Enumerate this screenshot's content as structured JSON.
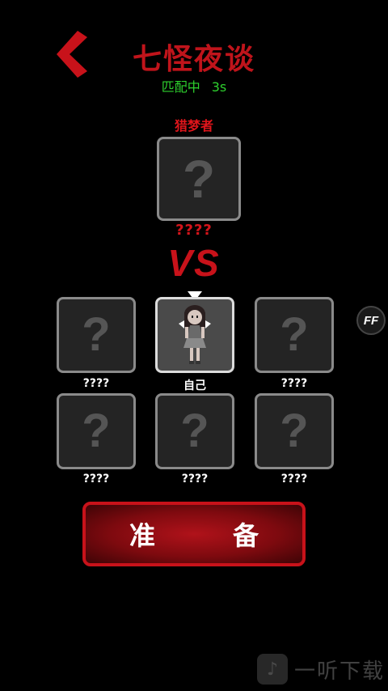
{
  "header": {
    "title": "七怪夜谈",
    "status": "匹配中",
    "timer": "3s"
  },
  "hunter": {
    "role_label": "猎梦者",
    "name": "????"
  },
  "vs_text": "VS",
  "players": [
    {
      "name": "????",
      "is_self": false
    },
    {
      "name": "自己",
      "is_self": true
    },
    {
      "name": "????",
      "is_self": false
    },
    {
      "name": "????",
      "is_self": false
    },
    {
      "name": "????",
      "is_self": false
    },
    {
      "name": "????",
      "is_self": false
    }
  ],
  "unknown_mark": "?",
  "ff_label": "FF",
  "ready_button": {
    "left": "准",
    "right": "备"
  },
  "watermark": {
    "text": "一听下载"
  },
  "colors": {
    "accent_red": "#c0141b",
    "status_green": "#2ed12e"
  }
}
